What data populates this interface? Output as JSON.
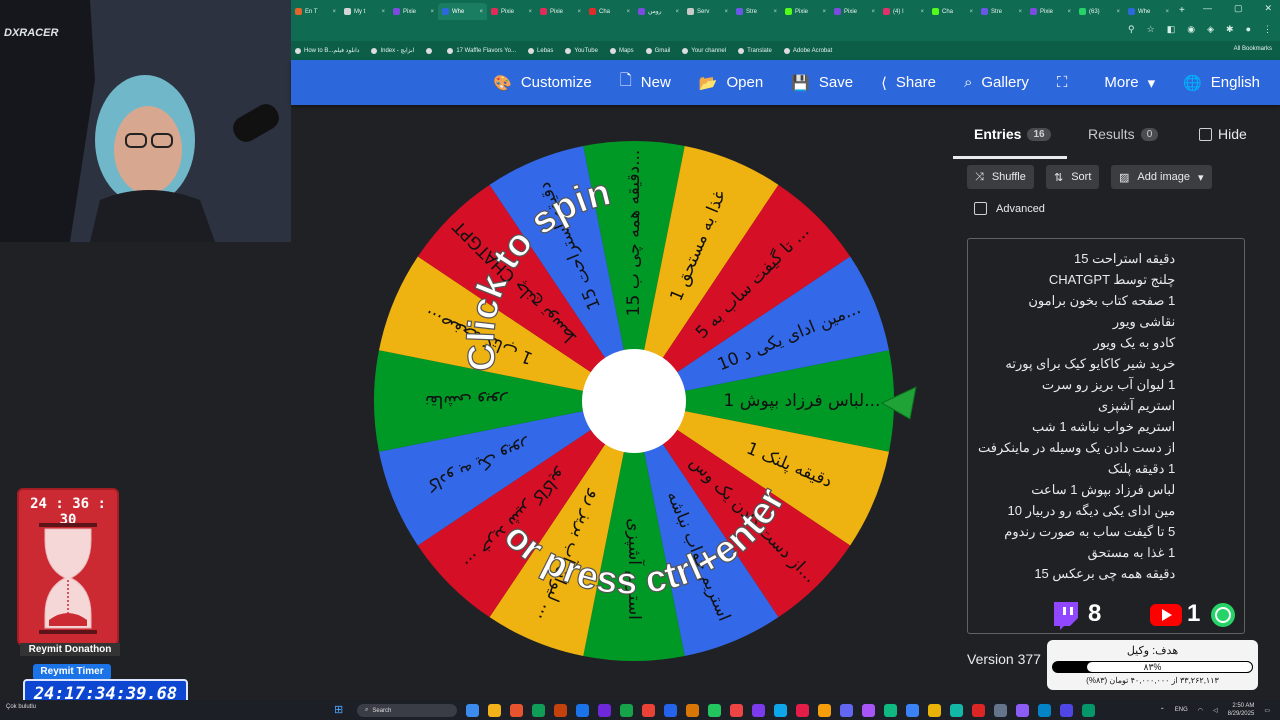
{
  "browser": {
    "tabs": [
      {
        "label": "En T",
        "color": "#e0642c"
      },
      {
        "label": "My t",
        "color": "#d5d5d5"
      },
      {
        "label": "Pixie",
        "color": "#7b4be0"
      },
      {
        "label": "Whe",
        "color": "#2c67dc",
        "active": true
      },
      {
        "label": "Pixie",
        "color": "#e02c5a"
      },
      {
        "label": "Pixie",
        "color": "#e02c5a"
      },
      {
        "label": "Cha",
        "color": "#e02c2c"
      },
      {
        "label": "رومن",
        "color": "#7b4be0"
      },
      {
        "label": "Serv",
        "color": "#c9c9c9"
      },
      {
        "label": "Stre",
        "color": "#6a57e8"
      },
      {
        "label": "Pixie",
        "color": "#53fc18"
      },
      {
        "label": "Pixie",
        "color": "#7b4be0"
      },
      {
        "label": "(4) I",
        "color": "#e1306c"
      },
      {
        "label": "Cha",
        "color": "#53fc18"
      },
      {
        "label": "Stre",
        "color": "#6a57e8"
      },
      {
        "label": "Pixie",
        "color": "#7b4be0"
      },
      {
        "label": "(63)",
        "color": "#25d366"
      },
      {
        "label": "Whe",
        "color": "#2c67dc"
      }
    ],
    "bookmarks": [
      "How to B...دانلود فیلم",
      "Index - ابزایچ",
      "",
      "17 Waffle Flavors Yo...",
      "Lebas",
      "YouTube",
      "Maps",
      "Gmail",
      "Your channel",
      "Translate",
      "Adobe Acrobat"
    ],
    "all_bookmarks": "All Bookmarks"
  },
  "header": {
    "items": [
      {
        "icon": "palette-icon",
        "glyph": "🎨",
        "label": "Customize"
      },
      {
        "icon": "new-file-icon",
        "glyph": "🗋",
        "label": "New"
      },
      {
        "icon": "folder-open-icon",
        "glyph": "📂",
        "label": "Open"
      },
      {
        "icon": "save-icon",
        "glyph": "💾",
        "label": "Save"
      },
      {
        "icon": "share-icon",
        "glyph": "⟨",
        "label": "Share"
      },
      {
        "icon": "search-icon",
        "glyph": "⌕",
        "label": "Gallery"
      },
      {
        "icon": "fullscreen-icon",
        "glyph": "⛶",
        "label": ""
      },
      {
        "icon": "chevron-down-icon",
        "glyph": "▾",
        "label": "More"
      },
      {
        "icon": "globe-icon",
        "glyph": "🌐",
        "label": "English"
      }
    ]
  },
  "wheel": {
    "center_text_top": "Click to spin",
    "center_text_bottom": "or press ctrl+enter",
    "colors": [
      "#3369e8",
      "#009925",
      "#eeb211",
      "#d50f25"
    ],
    "slices": [
      "1 لباس فرزاد بپوش...",
      "1 دقیقه پلنک",
      "از دست دادن یک وس...",
      "استریم خواب نباشه",
      "استریم آشپزی",
      "لیوان آب بریز رو ...",
      "خرید شیر کاکایو ...",
      "کادو به یک ویور",
      "نقاشی ویور",
      "1 صفحه کتاب...",
      "چلنج توسط CHATGPT",
      "15 دقیقه استراحت",
      "15 دقیقه همه چی ب...",
      "غذا به مستحق 1",
      "5 تا گیفت ساب به ...",
      "10 مین ادای یکی د..."
    ]
  },
  "panel": {
    "entries_label": "Entries",
    "entries_count": "16",
    "results_label": "Results",
    "results_count": "0",
    "hide_label": "Hide",
    "shuffle_label": "Shuffle",
    "sort_label": "Sort",
    "add_image_label": "Add image",
    "advanced_label": "Advanced",
    "entries": [
      "دقیقه استراحت 15",
      "CHATGPT چلنج توسط",
      "1 صفحه کتاب بخون برامون",
      "نقاشی ویور",
      "کادو به یک ویور",
      "خرید شیر کاکایو کیک برای پورته",
      "1 لیوان آب بریز رو سرت",
      "استریم آشپزی",
      "استریم خواب نباشه 1 شب",
      "از دست دادن یک وسیله در ماینکرفت",
      "1 دقیقه پلنک",
      "لباس فرزاد بپوش 1 ساعت",
      "مین ادای یکی دیگه رو دربیار 10",
      "5 تا گیفت ساب به صورت رندوم",
      "1 غذا به مستحق",
      "دقیقه همه چی برعکس 15"
    ],
    "version": "Version 377"
  },
  "overlay": {
    "timer_small": "24 : 36 : 30",
    "donathon_label": "Reymit Donathon",
    "reymit_label": "Reymit Timer",
    "big_timer": "24:17:34:39.68",
    "twitch_count": "8",
    "youtube_count": "1",
    "goal_title": "هدف: وکیل",
    "goal_pct": "۸۳%",
    "goal_progress": 0.83,
    "goal_detail": "۳۳,۲۶۲,۱۱۳ از ۴۰,۰۰۰,۰۰۰ تومان (۸۳%)"
  },
  "taskbar": {
    "weather": "Çok bulutlu",
    "search_label": "Search",
    "lang": "ENG",
    "time": "2:50 AM",
    "date": "8/29/2025"
  }
}
